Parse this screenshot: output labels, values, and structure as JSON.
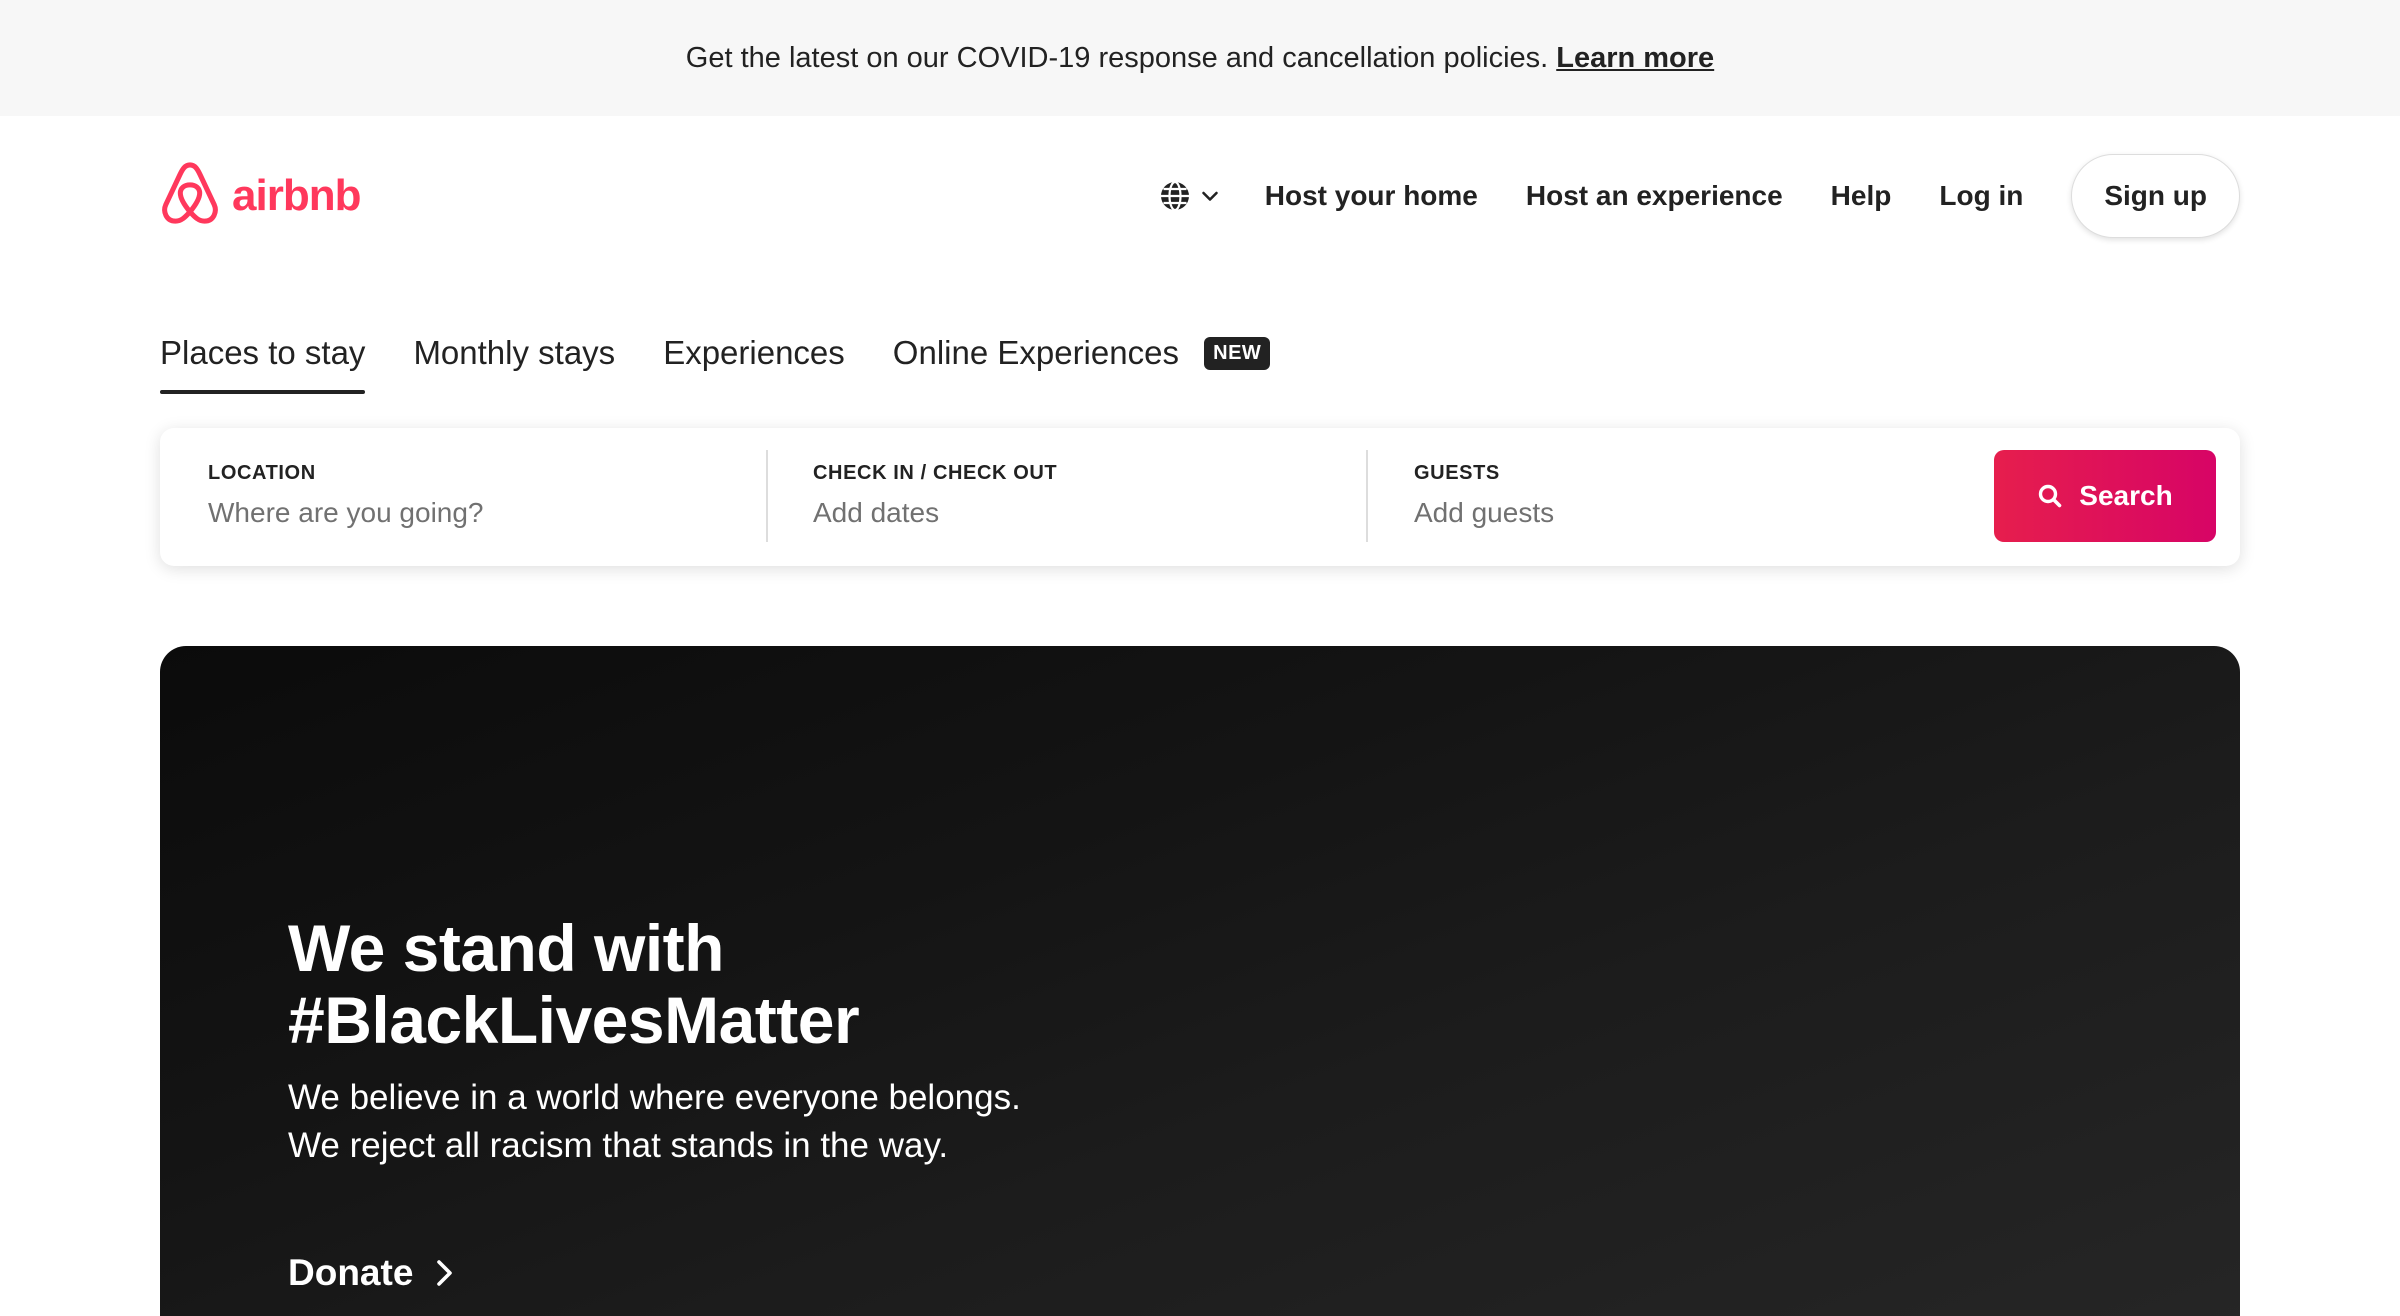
{
  "banner": {
    "text": "Get the latest on our COVID-19 response and cancellation policies.",
    "link": "Learn more"
  },
  "header": {
    "logo_text": "airbnb",
    "brand_color": "#FF385C",
    "language_icon": "globe-icon",
    "nav": {
      "host_home": "Host your home",
      "host_experience": "Host an experience",
      "help": "Help",
      "login": "Log in",
      "signup": "Sign up"
    }
  },
  "tabs": {
    "places": "Places to stay",
    "monthly": "Monthly stays",
    "experiences": "Experiences",
    "online": "Online Experiences",
    "online_badge": "NEW",
    "active": "Places to stay"
  },
  "search": {
    "location_label": "LOCATION",
    "location_placeholder": "Where are you going?",
    "dates_label": "CHECK IN / CHECK OUT",
    "dates_placeholder": "Add dates",
    "guests_label": "GUESTS",
    "guests_placeholder": "Add guests",
    "button_label": "Search",
    "button_icon": "search-icon",
    "accent_color": "#E61E4D"
  },
  "hero": {
    "title_line1": "We stand with",
    "title_line2": "#BlackLivesMatter",
    "body": "We believe in a world where everyone belongs. We reject all racism that stands in the way.",
    "link": "Donate",
    "link_icon": "chevron-right-icon"
  }
}
